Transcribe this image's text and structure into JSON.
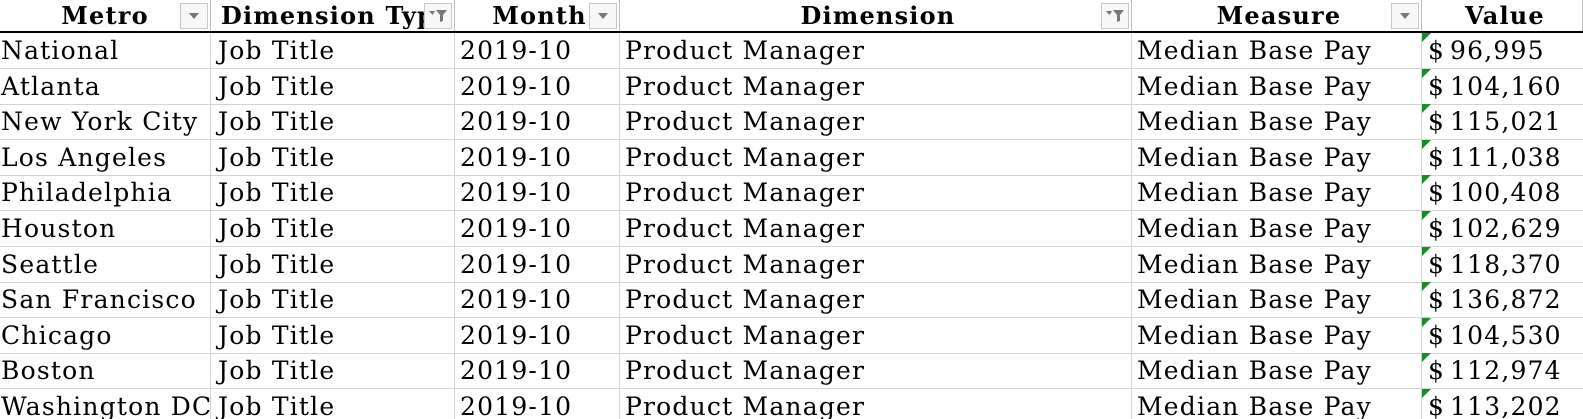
{
  "headers": {
    "metro": "Metro",
    "dimension_type": "Dimension Typ",
    "month": "Month",
    "dimension": "Dimension",
    "measure": "Measure",
    "value": "Value"
  },
  "header_filters": {
    "metro": "dropdown",
    "dimension_type": "filter-active",
    "month": "dropdown",
    "dimension": "filter-active",
    "measure": "dropdown"
  },
  "rows": [
    {
      "metro": "National",
      "dimension_type": "Job Title",
      "month": "2019-10",
      "dimension": "Product Manager",
      "measure": "Median Base Pay",
      "currency": "$",
      "value": "96,995"
    },
    {
      "metro": "Atlanta",
      "dimension_type": "Job Title",
      "month": "2019-10",
      "dimension": "Product Manager",
      "measure": "Median Base Pay",
      "currency": "$",
      "value": "104,160"
    },
    {
      "metro": "New York City",
      "dimension_type": "Job Title",
      "month": "2019-10",
      "dimension": "Product Manager",
      "measure": "Median Base Pay",
      "currency": "$",
      "value": "115,021"
    },
    {
      "metro": "Los Angeles",
      "dimension_type": "Job Title",
      "month": "2019-10",
      "dimension": "Product Manager",
      "measure": "Median Base Pay",
      "currency": "$",
      "value": "111,038"
    },
    {
      "metro": "Philadelphia",
      "dimension_type": "Job Title",
      "month": "2019-10",
      "dimension": "Product Manager",
      "measure": "Median Base Pay",
      "currency": "$",
      "value": "100,408"
    },
    {
      "metro": "Houston",
      "dimension_type": "Job Title",
      "month": "2019-10",
      "dimension": "Product Manager",
      "measure": "Median Base Pay",
      "currency": "$",
      "value": "102,629"
    },
    {
      "metro": "Seattle",
      "dimension_type": "Job Title",
      "month": "2019-10",
      "dimension": "Product Manager",
      "measure": "Median Base Pay",
      "currency": "$",
      "value": "118,370"
    },
    {
      "metro": "San Francisco",
      "dimension_type": "Job Title",
      "month": "2019-10",
      "dimension": "Product Manager",
      "measure": "Median Base Pay",
      "currency": "$",
      "value": "136,872"
    },
    {
      "metro": "Chicago",
      "dimension_type": "Job Title",
      "month": "2019-10",
      "dimension": "Product Manager",
      "measure": "Median Base Pay",
      "currency": "$",
      "value": "104,530"
    },
    {
      "metro": "Boston",
      "dimension_type": "Job Title",
      "month": "2019-10",
      "dimension": "Product Manager",
      "measure": "Median Base Pay",
      "currency": "$",
      "value": "112,974"
    },
    {
      "metro": "Washington DC",
      "dimension_type": "Job Title",
      "month": "2019-10",
      "dimension": "Product Manager",
      "measure": "Median Base Pay",
      "currency": "$",
      "value": "113,202"
    }
  ],
  "colors": {
    "gridline": "#d4d4d4",
    "error_indicator": "#1a8a2a"
  }
}
